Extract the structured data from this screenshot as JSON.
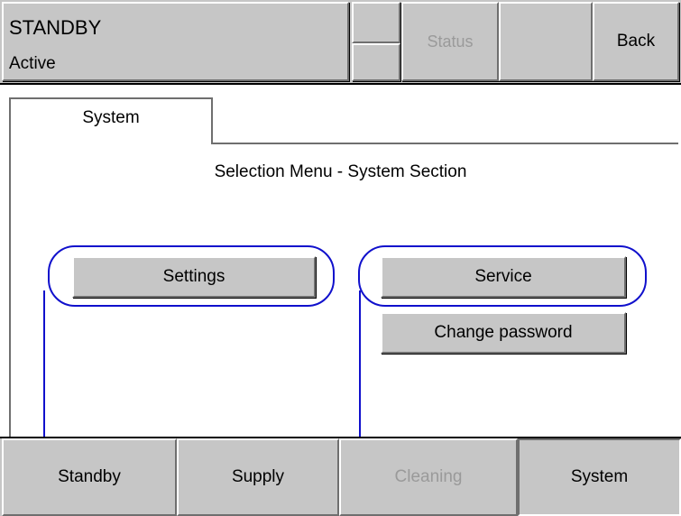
{
  "header": {
    "mode": "STANDBY",
    "state": "Active",
    "status_label": "Status",
    "back_label": "Back"
  },
  "tab": {
    "label": "System"
  },
  "main": {
    "title": "Selection Menu - System Section",
    "settings_label": "Settings",
    "service_label": "Service",
    "change_password_label": "Change password"
  },
  "nav": {
    "standby": "Standby",
    "supply": "Supply",
    "cleaning": "Cleaning",
    "system": "System"
  },
  "colors": {
    "panel_gray": "#c6c6c6",
    "disabled_text": "#9a9a9a",
    "callout_blue": "#1010cc"
  }
}
